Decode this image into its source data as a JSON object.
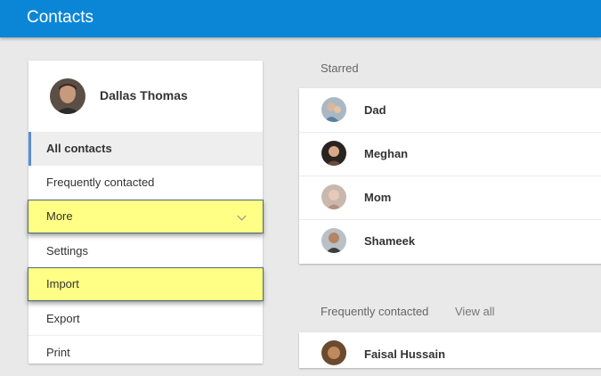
{
  "app": {
    "title": "Contacts"
  },
  "profile": {
    "name": "Dallas Thomas"
  },
  "nav": {
    "all_contacts": "All contacts",
    "frequently_contacted": "Frequently contacted",
    "more": "More",
    "settings": "Settings",
    "import": "Import",
    "export": "Export",
    "print": "Print"
  },
  "starred": {
    "label": "Starred",
    "contacts": [
      {
        "name": "Dad"
      },
      {
        "name": "Meghan"
      },
      {
        "name": "Mom"
      },
      {
        "name": "Shameek"
      }
    ]
  },
  "frequent": {
    "label": "Frequently contacted",
    "view_all": "View all",
    "contacts": [
      {
        "name": "Faisal Hussain"
      }
    ]
  },
  "colors": {
    "topbar": "#0b86d6",
    "highlight": "#ffff85",
    "active_indicator": "#5b8bd8"
  }
}
